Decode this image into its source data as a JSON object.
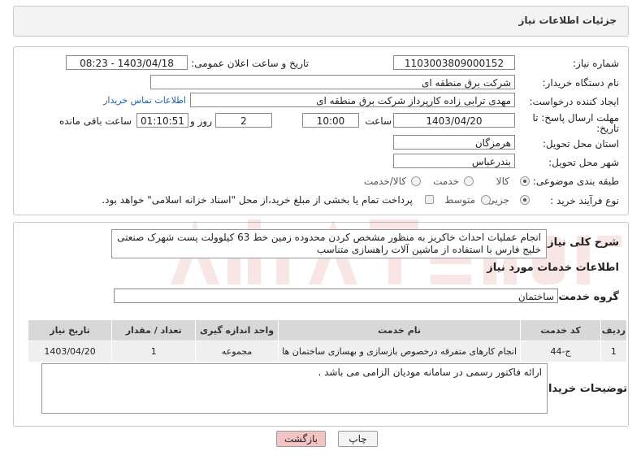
{
  "header": {
    "title": "جزئیات اطلاعات نیاز"
  },
  "fields": {
    "need_number_label": "شماره نیاز:",
    "need_number": "1103003809000152",
    "announce_label": "تاریخ و ساعت اعلان عمومی:",
    "announce_value": "1403/04/18 - 08:23",
    "buyer_org_label": "نام دستگاه خریدار:",
    "buyer_org": "شرکت برق منطقه ای",
    "creator_label": "ایجاد کننده درخواست:",
    "creator": "مهدی ترابی زاده کارپرداز شرکت برق منطقه ای",
    "contact_link": "اطلاعات تماس خریدار",
    "deadline_label_1": "مهلت ارسال پاسخ: تا",
    "deadline_label_2": "تاریخ:",
    "deadline_date": "1403/04/20",
    "time_label": "ساعت",
    "deadline_time": "10:00",
    "days_value": "2",
    "days_label": "روز و",
    "remaining_time": "01:10:51",
    "remaining_label": "ساعت باقی مانده",
    "province_label": "استان محل تحویل:",
    "province": "هرمزگان",
    "city_label": "شهر محل تحویل:",
    "city": "بندرعباس",
    "category_label": "طبقه بندی موضوعی:",
    "category_options": [
      "کالا",
      "خدمت",
      "کالا/خدمت"
    ],
    "process_label": "نوع فرآیند خرید :",
    "process_options": [
      "جزیی",
      "متوسط"
    ],
    "payment_note": "پرداخت تمام یا بخشی از مبلغ خرید،از محل \"اسناد خزانه اسلامی\" خواهد بود."
  },
  "summary": {
    "label": "شرح کلی نیاز:",
    "text": "انجام عملیات احداث خاکریز به منظور مشخص کردن محدوده زمین خط 63 کیلوولت پست شهرک صنعتی خلیج فارس با استفاده از ماشین آلات راهسازی متناسب",
    "services_title": "اطلاعات خدمات مورد نیاز",
    "service_group_label": "گروه خدمت:",
    "service_group": "ساختمان"
  },
  "table": {
    "headers": [
      "ردیف",
      "کد خدمت",
      "نام خدمت",
      "واحد اندازه گیری",
      "تعداد / مقدار",
      "تاریخ نیاز"
    ],
    "rows": [
      [
        "1",
        "ج-44",
        "انجام کارهای متفرقه درخصوص بازسازی و بهسازی ساختمان ها",
        "مجموعه",
        "1",
        "1403/04/20"
      ]
    ]
  },
  "buyer_notes": {
    "label": "توضیحات خریدار:",
    "text": "ارائه فاکتور رسمی در سامانه مودیان الزامی می باشد ."
  },
  "buttons": {
    "print": "چاپ",
    "back": "بازگشت"
  },
  "colors": {
    "back_button_bg": "#f2c4c4",
    "link": "#1a5fb4",
    "table_header": "#d8d8d8"
  }
}
